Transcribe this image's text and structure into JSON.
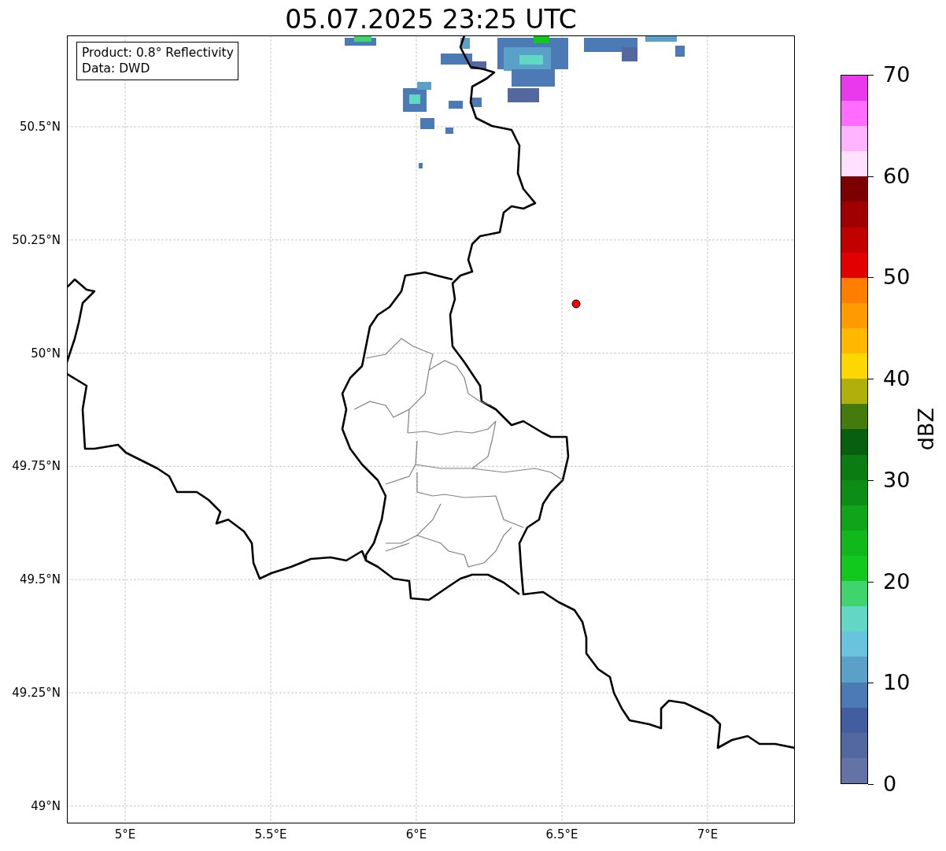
{
  "title": "05.07.2025 23:25 UTC",
  "info_box": {
    "lines": [
      "Product: 0.8° Reflectivity",
      "Data: DWD"
    ]
  },
  "map": {
    "lat_labels": [
      "50.5°N",
      "50.25°N",
      "50°N",
      "49.75°N",
      "49.5°N",
      "49.25°N",
      "49°N"
    ],
    "lon_labels": [
      "5°E",
      "5.5°E",
      "6°E",
      "6.5°E",
      "7°E"
    ],
    "marker": {
      "color": "#ff0000"
    }
  },
  "colorbar": {
    "label": "dBZ",
    "ticks": [
      "70",
      "60",
      "50",
      "40",
      "30",
      "20",
      "10",
      "0"
    ],
    "bins": [
      {
        "color": "#6473a6"
      },
      {
        "color": "#52689e"
      },
      {
        "color": "#425da0"
      },
      {
        "color": "#4b7ab5"
      },
      {
        "color": "#5ba0c8"
      },
      {
        "color": "#68c3dd"
      },
      {
        "color": "#62d7c5"
      },
      {
        "color": "#3fd46e"
      },
      {
        "color": "#12c81c"
      },
      {
        "color": "#10b81c"
      },
      {
        "color": "#0fa41a"
      },
      {
        "color": "#0c8d16"
      },
      {
        "color": "#0a7c12"
      },
      {
        "color": "#085f0e"
      },
      {
        "color": "#457a0c"
      },
      {
        "color": "#b0b00a"
      },
      {
        "color": "#ffd700"
      },
      {
        "color": "#ffb800"
      },
      {
        "color": "#ff9a00"
      },
      {
        "color": "#ff7e00"
      },
      {
        "color": "#e20000"
      },
      {
        "color": "#c10000"
      },
      {
        "color": "#a00000"
      },
      {
        "color": "#7c0000"
      },
      {
        "color": "#ffe0ff"
      },
      {
        "color": "#ffb4ff"
      },
      {
        "color": "#ff6cff"
      },
      {
        "color": "#ea38ec"
      }
    ]
  }
}
